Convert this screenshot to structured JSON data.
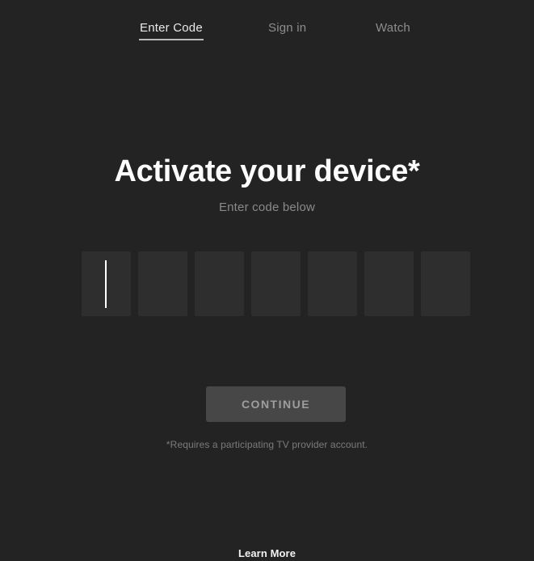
{
  "page": {
    "background_color": "#232323"
  },
  "nav": {
    "items": [
      {
        "label": "Enter Code",
        "active": true
      },
      {
        "label": "Sign in",
        "active": false
      },
      {
        "label": "Watch",
        "active": false
      }
    ]
  },
  "main": {
    "headline": "Activate your device*",
    "subtitle": "Enter code below",
    "code_entry": {
      "box_count": 7,
      "focused_index": 0,
      "values": [
        "",
        "",
        "",
        "",
        "",
        "",
        ""
      ]
    },
    "continue_button": {
      "label": "CONTINUE",
      "enabled": false,
      "background_color": "#474747",
      "text_color": "#9e9e9e"
    },
    "footnote": "*Requires a participating TV provider account."
  },
  "footer": {
    "learn_more": "Learn More"
  }
}
